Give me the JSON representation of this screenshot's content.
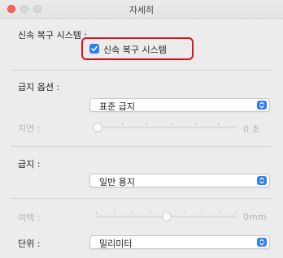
{
  "window": {
    "title": "자세히",
    "buttons": [
      "close-button",
      "minimize-button",
      "zoom-button"
    ]
  },
  "rapid_recovery": {
    "section_label": "신속 복구 시스템 :",
    "checkbox_label": "신속 복구 시스템",
    "checked": true,
    "highlight_color": "#d8141c"
  },
  "feed_options": {
    "section_label": "급지 옵션 :",
    "selected": "표준 급지"
  },
  "delay": {
    "label": "지연 :",
    "value_text": "0 초",
    "value": 0,
    "enabled": false
  },
  "feed": {
    "section_label": "급지 :",
    "selected": "일반 용지"
  },
  "margin": {
    "label": "여백 :",
    "value_text": "0mm",
    "value": 0,
    "enabled": false
  },
  "units": {
    "label": "단위 :",
    "selected": "밀리미터"
  },
  "colors": {
    "accent": "#2f7df6",
    "window_bg": "#ececec",
    "disabled_text": "#b5b5b5"
  }
}
